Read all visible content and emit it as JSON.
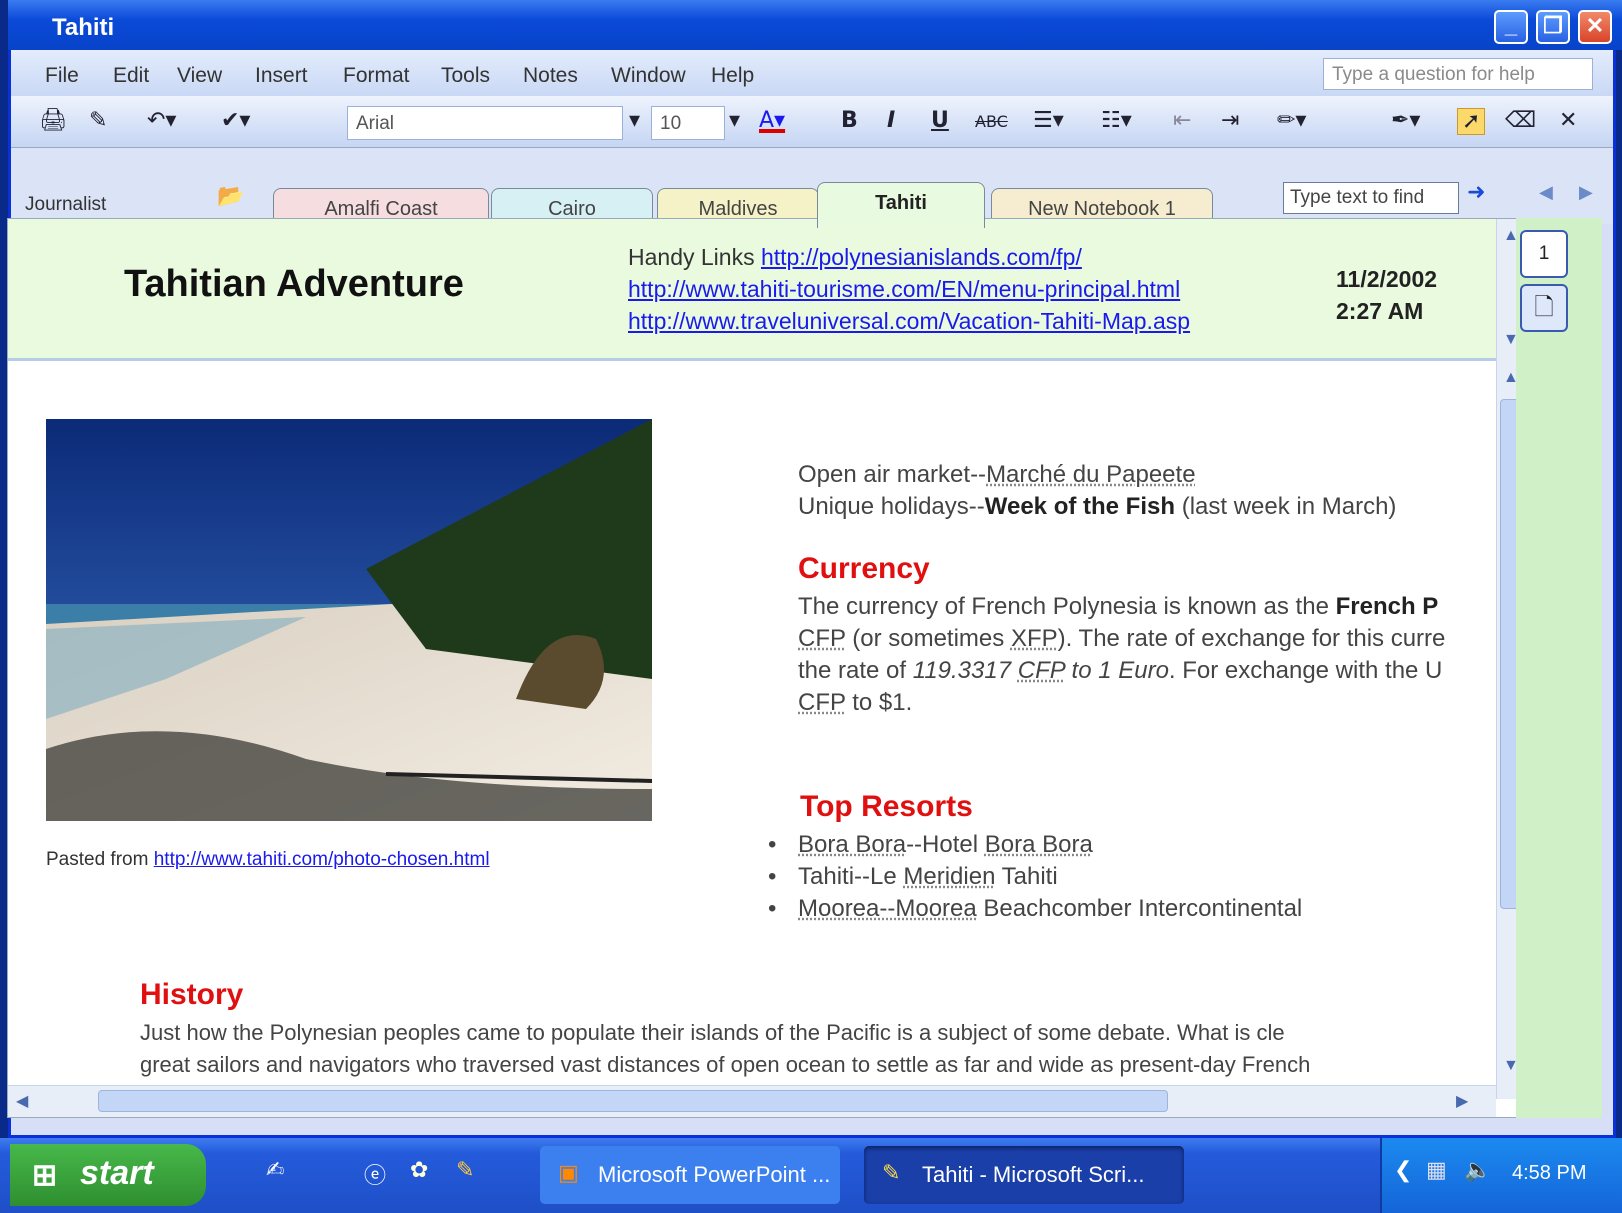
{
  "window": {
    "title": "Tahiti"
  },
  "menu": [
    "File",
    "Edit",
    "View",
    "Insert",
    "Format",
    "Tools",
    "Notes",
    "Window",
    "Help"
  ],
  "help_placeholder": "Type a question for help",
  "toolbar": {
    "font": "Arial",
    "size": "10"
  },
  "journalist_label": "Journalist",
  "tabs": [
    "Amalfi Coast",
    "Cairo",
    "Maldives",
    "Tahiti",
    "New Notebook 1"
  ],
  "find_placeholder": "Type text to find",
  "page": {
    "title": "Tahitian Adventure",
    "handy_label": "Handy Links",
    "links": [
      "http://polynesianislands.com/fp/",
      "http://www.tahiti-tourisme.com/EN/menu-principal.html",
      "http://www.traveluniversal.com/Vacation-Tahiti-Map.asp"
    ],
    "date": "11/2/2002",
    "time": "2:27 AM",
    "pasted_label": "Pasted from",
    "pasted_link": "http://www.tahiti.com/photo-chosen.html",
    "market_label": "Open air market--",
    "market_value": "Marché du Papeete",
    "holiday_label": "Unique holidays--",
    "holiday_value": "Week of the Fish",
    "holiday_note": " (last week in March)",
    "currency_heading": "Currency",
    "currency_lines": {
      "l1a": "The currency of French Polynesia is known as the ",
      "l1b": "French P",
      "l2a": "CFP",
      "l2b": " (or sometimes ",
      "l2c": "XFP",
      "l2d": "). The rate of exchange for this curre",
      "l3a": "the rate of ",
      "l3b": "119.3317 ",
      "l3c": "CFP",
      "l3d": " to 1 Euro",
      "l3e": ". For exchange with the U",
      "l4a": "CFP",
      "l4b": " to $1."
    },
    "resorts_heading": "Top Resorts",
    "resorts": [
      {
        "a": "Bora Bora",
        "b": "--Hotel ",
        "c": "Bora Bora",
        "d": ""
      },
      {
        "a": "",
        "b": "Tahiti--Le ",
        "c": "Meridien",
        "d": " Tahiti"
      },
      {
        "a": "Moorea--Moorea",
        "b": " Beachcomber Intercontinental",
        "c": "",
        "d": ""
      }
    ],
    "history_heading": "History",
    "history_l1": "Just how the Polynesian peoples came to populate their islands of the Pacific is a subject of some debate. What is cle",
    "history_l2": "great sailors and navigators who traversed vast distances of open ocean to settle as far and wide as present-day French"
  },
  "sidepanel": {
    "page_number": "1"
  },
  "taskbar": {
    "start": "start",
    "items": [
      "Microsoft PowerPoint ...",
      "Tahiti - Microsoft Scri..."
    ],
    "clock": "4:58 PM"
  }
}
